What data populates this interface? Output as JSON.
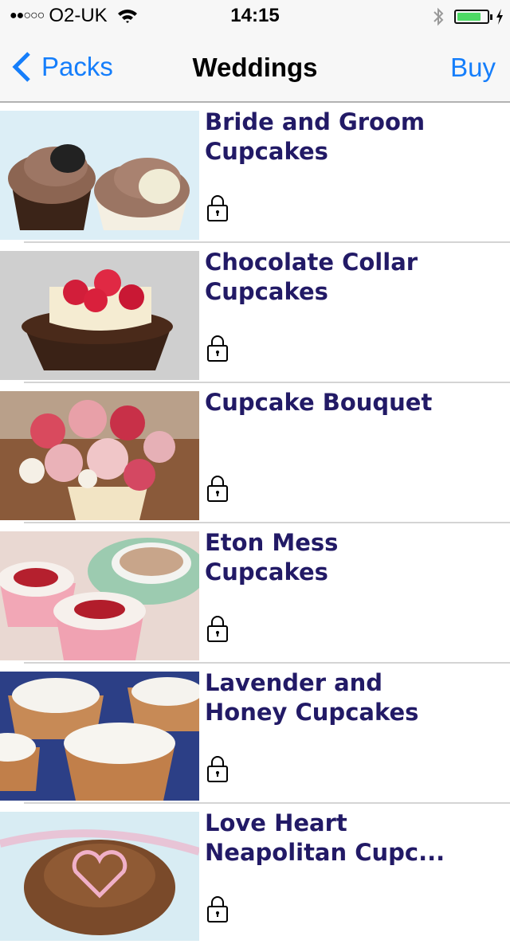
{
  "status_bar": {
    "signal": "●●○○○",
    "carrier": "O2-UK",
    "time": "14:15",
    "battery_level": 0.8,
    "battery_color": "#4cd964",
    "charging": true
  },
  "nav": {
    "back_label": "Packs",
    "title": "Weddings",
    "buy_label": "Buy",
    "accent_color": "#157efb"
  },
  "recipes": [
    {
      "title": "Bride and Groom\nCupcakes",
      "locked": true,
      "icon": "lock-icon"
    },
    {
      "title": "Chocolate Collar\nCupcakes",
      "locked": true,
      "icon": "lock-icon"
    },
    {
      "title": "Cupcake Bouquet",
      "locked": true,
      "icon": "lock-icon"
    },
    {
      "title": "Eton Mess\nCupcakes",
      "locked": true,
      "icon": "lock-icon"
    },
    {
      "title": "Lavender and\nHoney Cupcakes",
      "locked": true,
      "icon": "lock-icon"
    },
    {
      "title": "Love Heart\nNeapolitan Cupc...",
      "locked": true,
      "icon": "lock-icon"
    }
  ],
  "title_color": "#221a66"
}
